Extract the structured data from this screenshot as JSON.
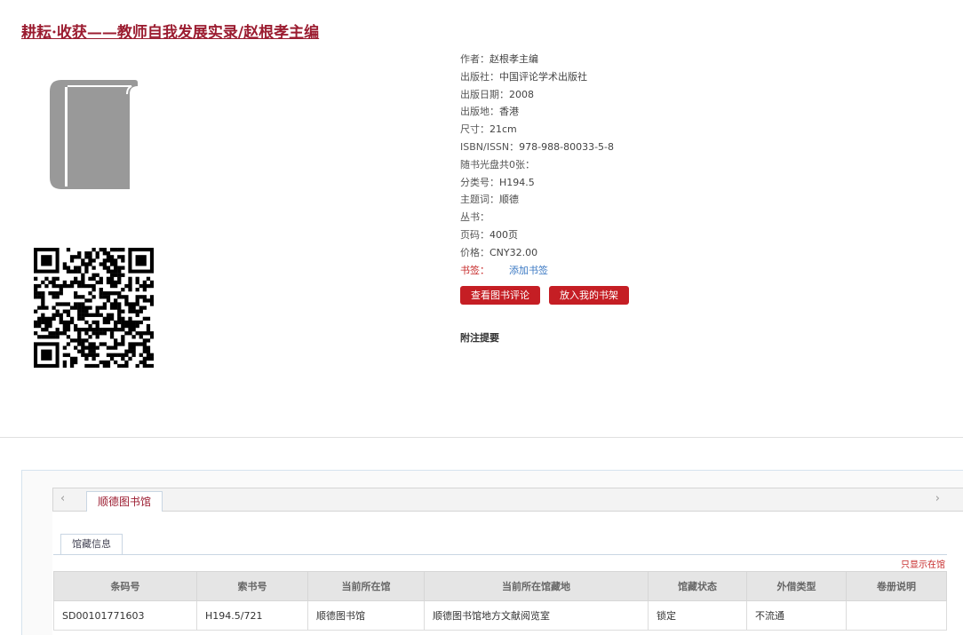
{
  "book": {
    "title": "耕耘·收获——教师自我发展实录/赵根孝主编"
  },
  "icons": {
    "cover": "book-icon",
    "qr": "qr-code-icon",
    "prev": "chevron-left-icon",
    "next": "chevron-right-icon"
  },
  "metadata": [
    {
      "label": "作者：",
      "value": "赵根孝主编"
    },
    {
      "label": "出版社：",
      "value": "中国评论学术出版社"
    },
    {
      "label": "出版日期：",
      "value": "2008"
    },
    {
      "label": "出版地：",
      "value": "香港"
    },
    {
      "label": "尺寸：",
      "value": "21cm"
    },
    {
      "label": "ISBN/ISSN：",
      "value": "978-988-80033-5-8"
    },
    {
      "label": "随书光盘共0张：",
      "value": ""
    },
    {
      "label": "分类号：",
      "value": "H194.5"
    },
    {
      "label": "主题词：",
      "value": "顺德"
    },
    {
      "label": "丛书：",
      "value": ""
    },
    {
      "label": "页码：",
      "value": "400页"
    },
    {
      "label": "价格：",
      "value": "CNY32.00"
    }
  ],
  "bookmark": {
    "label": "书签：",
    "add_label": "添加书签"
  },
  "buttons": {
    "reviews": "查看图书评论",
    "shelf": "放入我的书架"
  },
  "notes_heading": "附注提要",
  "library_tab": "顺德图书馆",
  "holdings": {
    "tab_label": "馆藏信息",
    "only_link": "只显示在馆",
    "columns": [
      "条码号",
      "索书号",
      "当前所在馆",
      "当前所在馆藏地",
      "馆藏状态",
      "外借类型",
      "卷册说明"
    ],
    "rows": [
      [
        "SD00101771603",
        "H194.5/721",
        "顺德图书馆",
        "顺德图书馆地方文献阅览室",
        "锁定",
        "不流通",
        ""
      ]
    ]
  },
  "colors": {
    "title": "#9b1c30",
    "button": "#c51e24",
    "link": "#3a78c3",
    "cover_icon": "#999999"
  }
}
